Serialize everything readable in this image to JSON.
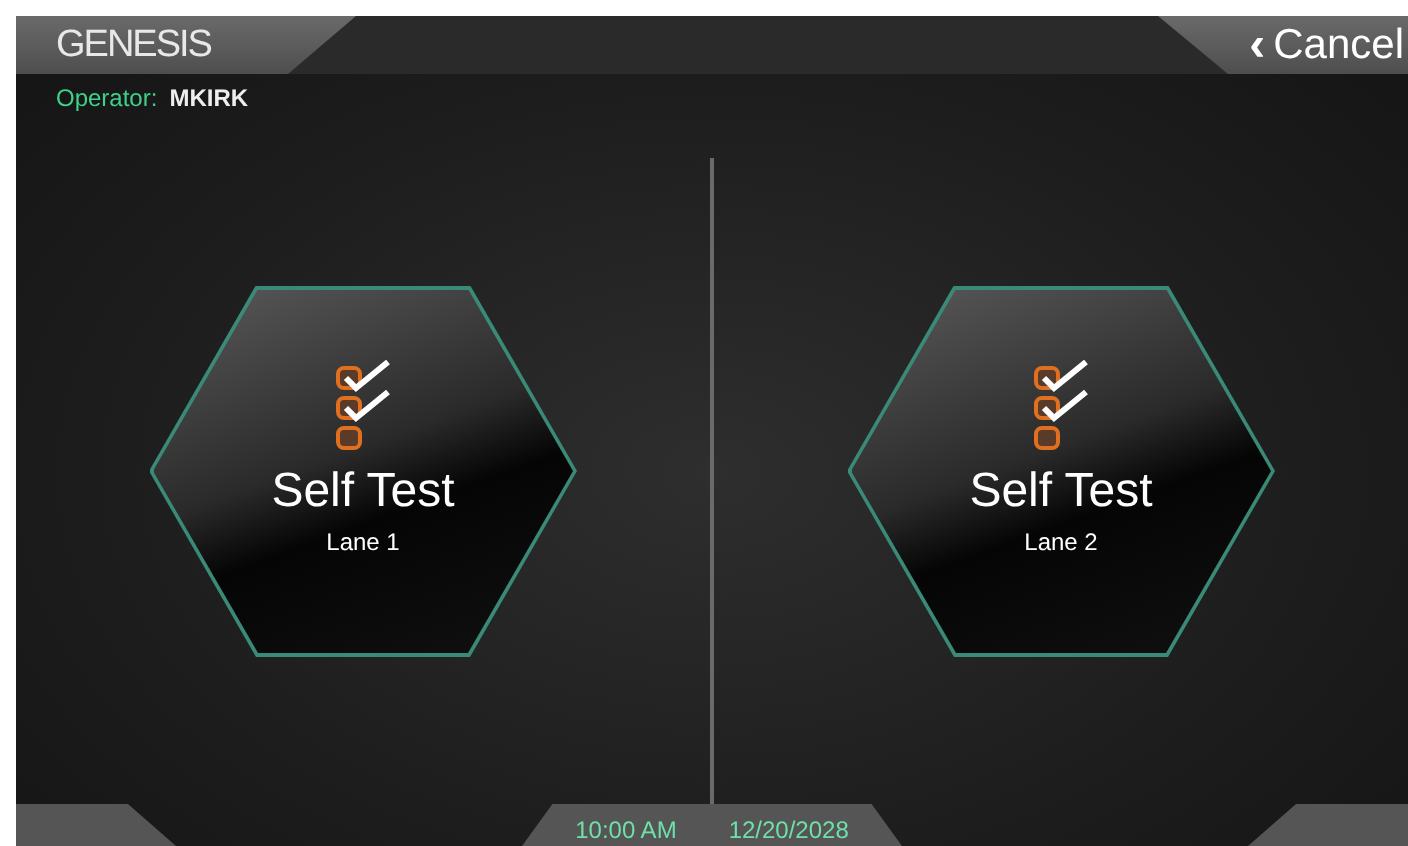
{
  "header": {
    "title": "GENESIS",
    "cancel": {
      "icon": "‹",
      "label": "Cancel"
    }
  },
  "operator": {
    "label": "Operator:",
    "name": "MKIRK"
  },
  "lanes": [
    {
      "title": "Self Test",
      "subtitle": "Lane 1"
    },
    {
      "title": "Self Test",
      "subtitle": "Lane 2"
    }
  ],
  "footer": {
    "time": "10:00 AM",
    "date": "12/20/2028"
  }
}
